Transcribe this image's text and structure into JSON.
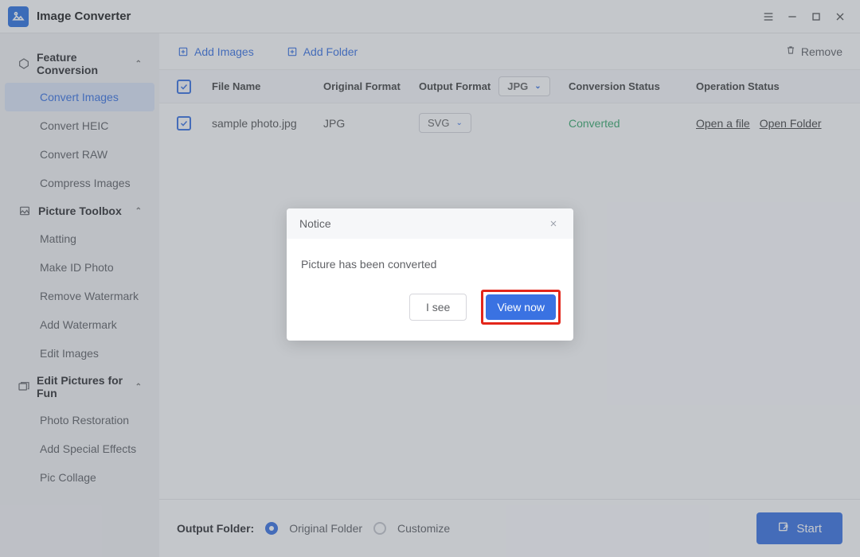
{
  "app": {
    "title": "Image Converter"
  },
  "sidebar": {
    "sections": [
      {
        "label": "Feature Conversion",
        "items": [
          "Convert Images",
          "Convert HEIC",
          "Convert RAW",
          "Compress Images"
        ],
        "active": 0
      },
      {
        "label": "Picture Toolbox",
        "items": [
          "Matting",
          "Make ID Photo",
          "Remove Watermark",
          "Add Watermark",
          "Edit Images"
        ]
      },
      {
        "label": "Edit Pictures for Fun",
        "items": [
          "Photo Restoration",
          "Add Special Effects",
          "Pic Collage"
        ]
      }
    ]
  },
  "toolbar": {
    "add_images": "Add Images",
    "add_folder": "Add Folder",
    "remove": "Remove"
  },
  "table": {
    "headers": {
      "file_name": "File Name",
      "original_format": "Original Format",
      "output_format": "Output Format",
      "conversion_status": "Conversion Status",
      "operation_status": "Operation Status"
    },
    "header_output_value": "JPG",
    "rows": [
      {
        "file_name": "sample photo.jpg",
        "original_format": "JPG",
        "output_format": "SVG",
        "conversion_status": "Converted",
        "ops": [
          "Open a file",
          "Open Folder"
        ]
      }
    ]
  },
  "footer": {
    "label": "Output Folder:",
    "option_original": "Original Folder",
    "option_custom": "Customize",
    "selected": "original",
    "start": "Start"
  },
  "dialog": {
    "title": "Notice",
    "message": "Picture has been converted",
    "cancel": "I see",
    "confirm": "View now"
  }
}
